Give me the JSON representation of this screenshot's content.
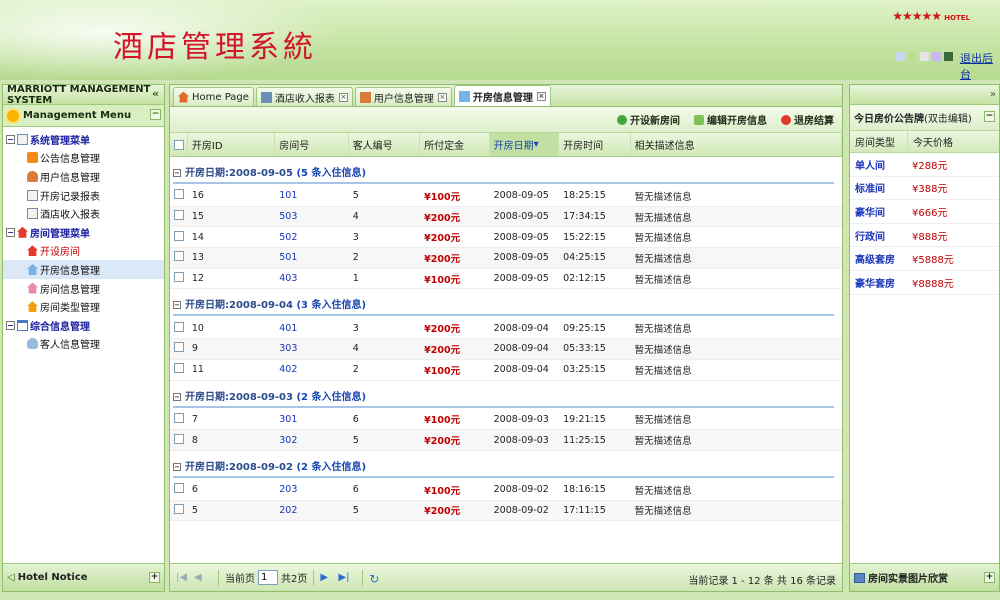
{
  "header": {
    "title": "酒店管理系統",
    "brand_stars": "★★★★★",
    "brand_text": "HOTEL",
    "logout": "退出后台",
    "theme_colors": [
      "#c9d8ee",
      "#b9e08f",
      "#e4e4e4",
      "#c7b7ee",
      "#3b6a3f"
    ]
  },
  "left": {
    "system_name": "MARRIOTT MANAGEMENT SYSTEM",
    "menu_title": "Management Menu",
    "footer": "Hotel Notice",
    "tree": [
      {
        "type": "group",
        "label": "系统管理菜单",
        "icon": "doc-icon",
        "children": [
          {
            "label": "公告信息管理",
            "icon": "rss-icon"
          },
          {
            "label": "用户信息管理",
            "icon": "user-icon"
          },
          {
            "label": "开房记录报表",
            "icon": "report-icon"
          },
          {
            "label": "酒店收入报表",
            "icon": "table-icon"
          }
        ]
      },
      {
        "type": "group",
        "label": "房间管理菜单",
        "icon": "home-icon",
        "children": [
          {
            "label": "开设房间",
            "icon": "red-house-icon",
            "red": true
          },
          {
            "label": "开房信息管理",
            "icon": "blue-house-icon",
            "selected": true
          },
          {
            "label": "房间信息管理",
            "icon": "pink-house-icon"
          },
          {
            "label": "房间类型管理",
            "icon": "yellow-house-icon"
          }
        ]
      },
      {
        "type": "group",
        "label": "综合信息管理",
        "icon": "window-icon",
        "children": [
          {
            "label": "客人信息管理",
            "icon": "person-icon"
          }
        ]
      }
    ]
  },
  "tabs": [
    {
      "label": "Home Page",
      "icon": "home-tab-icon",
      "closable": false
    },
    {
      "label": "酒店收入报表",
      "icon": "table-tab-icon",
      "closable": true
    },
    {
      "label": "用户信息管理",
      "icon": "user-tab-icon",
      "closable": true
    },
    {
      "label": "开房信息管理",
      "icon": "house-tab-icon",
      "closable": true,
      "active": true
    }
  ],
  "toolbar": {
    "new_room": "开设新房间",
    "edit_room": "编辑开房信息",
    "checkout": "退房结算"
  },
  "grid": {
    "columns": [
      "开房ID",
      "房间号",
      "客人编号",
      "所付定金",
      "开房日期",
      "开房时间",
      "相关描述信息"
    ],
    "sorted_column": "开房日期",
    "group_prefix": "开房日期: ",
    "groups": [
      {
        "date": "2008-09-05",
        "count_label": "(5 条入住信息)",
        "rows": [
          {
            "id": "16",
            "room": "101",
            "guest": "5",
            "deposit": "¥100元",
            "date": "2008-09-05",
            "time": "18:25:15",
            "desc": "暂无描述信息"
          },
          {
            "id": "15",
            "room": "503",
            "guest": "4",
            "deposit": "¥200元",
            "date": "2008-09-05",
            "time": "17:34:15",
            "desc": "暂无描述信息"
          },
          {
            "id": "14",
            "room": "502",
            "guest": "3",
            "deposit": "¥200元",
            "date": "2008-09-05",
            "time": "15:22:15",
            "desc": "暂无描述信息"
          },
          {
            "id": "13",
            "room": "501",
            "guest": "2",
            "deposit": "¥200元",
            "date": "2008-09-05",
            "time": "04:25:15",
            "desc": "暂无描述信息"
          },
          {
            "id": "12",
            "room": "403",
            "guest": "1",
            "deposit": "¥100元",
            "date": "2008-09-05",
            "time": "02:12:15",
            "desc": "暂无描述信息"
          }
        ]
      },
      {
        "date": "2008-09-04",
        "count_label": "(3 条入住信息)",
        "rows": [
          {
            "id": "10",
            "room": "401",
            "guest": "3",
            "deposit": "¥200元",
            "date": "2008-09-04",
            "time": "09:25:15",
            "desc": "暂无描述信息"
          },
          {
            "id": "9",
            "room": "303",
            "guest": "4",
            "deposit": "¥200元",
            "date": "2008-09-04",
            "time": "05:33:15",
            "desc": "暂无描述信息"
          },
          {
            "id": "11",
            "room": "402",
            "guest": "2",
            "deposit": "¥100元",
            "date": "2008-09-04",
            "time": "03:25:15",
            "desc": "暂无描述信息"
          }
        ]
      },
      {
        "date": "2008-09-03",
        "count_label": "(2 条入住信息)",
        "rows": [
          {
            "id": "7",
            "room": "301",
            "guest": "6",
            "deposit": "¥100元",
            "date": "2008-09-03",
            "time": "19:21:15",
            "desc": "暂无描述信息"
          },
          {
            "id": "8",
            "room": "302",
            "guest": "5",
            "deposit": "¥200元",
            "date": "2008-09-03",
            "time": "11:25:15",
            "desc": "暂无描述信息"
          }
        ]
      },
      {
        "date": "2008-09-02",
        "count_label": "(2 条入住信息)",
        "rows": [
          {
            "id": "6",
            "room": "203",
            "guest": "6",
            "deposit": "¥100元",
            "date": "2008-09-02",
            "time": "18:16:15",
            "desc": "暂无描述信息"
          },
          {
            "id": "5",
            "room": "202",
            "guest": "5",
            "deposit": "¥200元",
            "date": "2008-09-02",
            "time": "17:11:15",
            "desc": "暂无描述信息"
          }
        ]
      }
    ]
  },
  "pager": {
    "current_label": "当前页",
    "page_value": "1",
    "total_label": "共2页",
    "info": "当前记录 1 - 12 条 共 16 条记录"
  },
  "right": {
    "title": "今日房价公告牌",
    "hint": "(双击编辑)",
    "col_type": "房间类型",
    "col_price": "今天价格",
    "prices": [
      {
        "type": "单人间",
        "price": "¥288元"
      },
      {
        "type": "标准间",
        "price": "¥388元"
      },
      {
        "type": "豪华间",
        "price": "¥666元"
      },
      {
        "type": "行政间",
        "price": "¥888元"
      },
      {
        "type": "高级套房",
        "price": "¥5888元"
      },
      {
        "type": "豪华套房",
        "price": "¥8888元"
      }
    ],
    "footer": "房间实景图片欣赏"
  }
}
